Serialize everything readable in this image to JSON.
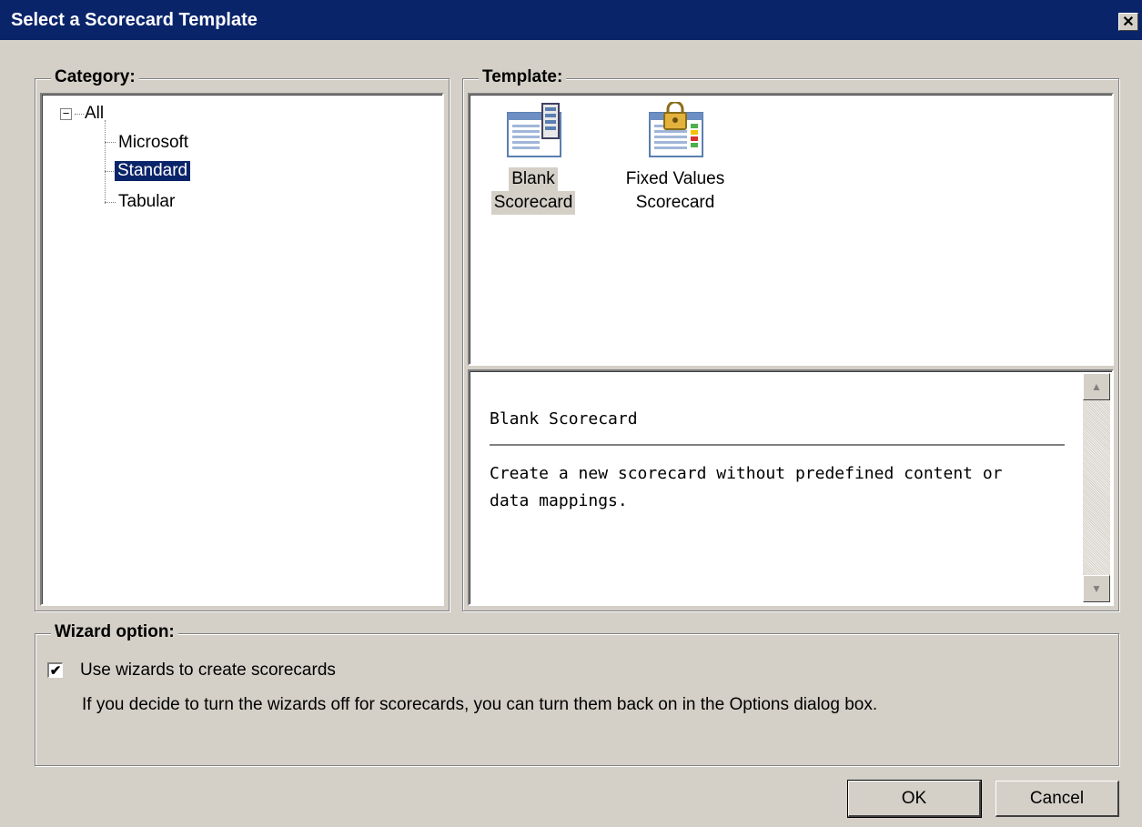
{
  "window": {
    "title": "Select a Scorecard Template",
    "close_glyph": "✕"
  },
  "category": {
    "legend": "Category:",
    "root": {
      "label": "All",
      "expander": "−"
    },
    "children": [
      "Microsoft",
      "Standard",
      "Tabular"
    ],
    "selected": "Standard"
  },
  "template": {
    "legend": "Template:",
    "items": [
      {
        "line1": "Blank",
        "line2": "Scorecard",
        "icon": "blank-scorecard-icon"
      },
      {
        "line1": "Fixed Values",
        "line2": "Scorecard",
        "icon": "fixed-values-scorecard-icon"
      }
    ],
    "selected": "Blank Scorecard"
  },
  "description": {
    "title": "Blank Scorecard",
    "text_line1": "Create a new scorecard without predefined content or",
    "text_line2": "data mappings."
  },
  "wizard": {
    "legend": "Wizard option:",
    "checkbox_label": "Use wizards to create scorecards",
    "checked": true,
    "check_glyph": "✔",
    "note": "If you decide to turn the wizards off for scorecards, you can turn them back on in the Options dialog box."
  },
  "buttons": {
    "ok": "OK",
    "cancel": "Cancel"
  },
  "colors": {
    "titlebar": "#0a246a",
    "dialog_bg": "#d4d0c8",
    "selection": "#0a246a"
  }
}
